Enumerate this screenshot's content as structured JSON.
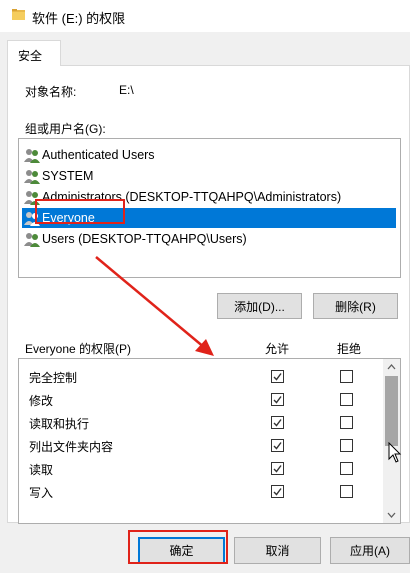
{
  "window": {
    "title": "软件 (E:) 的权限"
  },
  "tabs": [
    {
      "label": "安全",
      "selected": true
    }
  ],
  "object": {
    "label": "对象名称:",
    "value": "E:\\"
  },
  "groups": {
    "label": "组或用户名(G):",
    "items": [
      {
        "label": "Authenticated Users",
        "selected": false
      },
      {
        "label": "SYSTEM",
        "selected": false
      },
      {
        "label": "Administrators (DESKTOP-TTQAHPQ\\Administrators)",
        "selected": false
      },
      {
        "label": "Everyone",
        "selected": true
      },
      {
        "label": "Users (DESKTOP-TTQAHPQ\\Users)",
        "selected": false
      }
    ]
  },
  "buttons": {
    "add": "添加(D)...",
    "remove": "删除(R)",
    "ok": "确定",
    "cancel": "取消",
    "apply": "应用(A)"
  },
  "permissions": {
    "label": "Everyone 的权限(P)",
    "allow_header": "允许",
    "deny_header": "拒绝",
    "items": [
      {
        "label": "完全控制",
        "allow": true,
        "deny": false
      },
      {
        "label": "修改",
        "allow": true,
        "deny": false
      },
      {
        "label": "读取和执行",
        "allow": true,
        "deny": false
      },
      {
        "label": "列出文件夹内容",
        "allow": true,
        "deny": false
      },
      {
        "label": "读取",
        "allow": true,
        "deny": false
      },
      {
        "label": "写入",
        "allow": true,
        "deny": false
      }
    ]
  },
  "colors": {
    "selection": "#0078d7",
    "highlight": "#e0231a",
    "face": "#f0f0f0"
  }
}
